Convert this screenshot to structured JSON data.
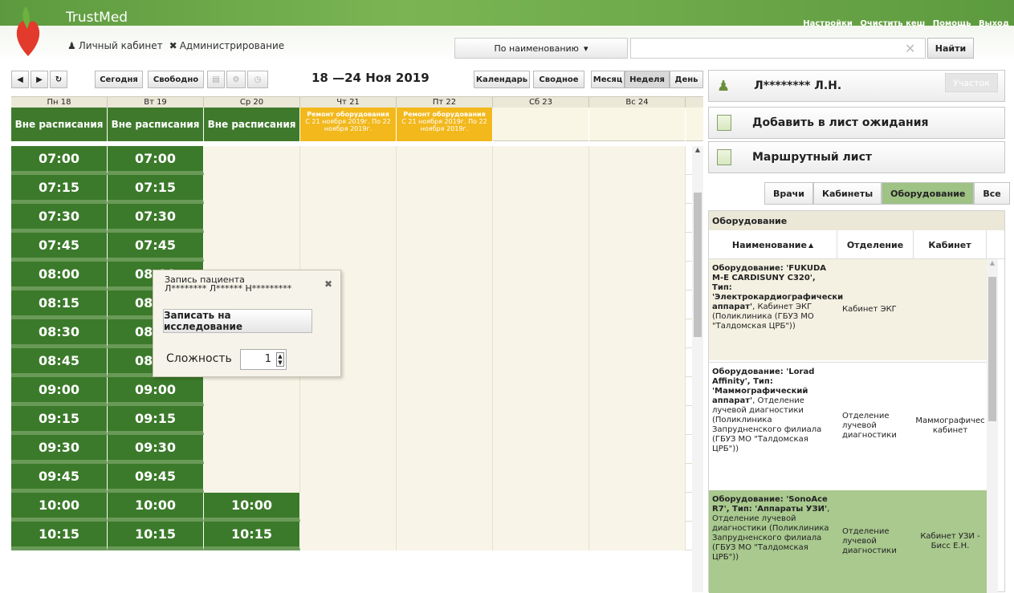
{
  "app": {
    "title": "TrustMed"
  },
  "top_links": [
    "Настройки",
    "Очистить кеш",
    "Помощь",
    "Выход"
  ],
  "nav": {
    "cabinet": "Личный кабинет",
    "admin": "Администрирование"
  },
  "search": {
    "mode": "По наименованию",
    "value": "",
    "button": "Найти"
  },
  "toolbar": {
    "today": "Сегодня",
    "free": "Свободно",
    "week_title": "18 —24 Ноя 2019",
    "views": [
      "Календарь",
      "Сводное",
      "Месяц",
      "Неделя",
      "День"
    ]
  },
  "days": [
    "Пн 18",
    "Вт 19",
    "Ср 20",
    "Чт 21",
    "Пт 22",
    "Сб 23",
    "Вс 24"
  ],
  "offschedule": {
    "label": "Вне расписания",
    "repair_line1": "Ремонт оборудования",
    "repair_line2": "С 21 ноября 2019г. По 22 ноября 2019г."
  },
  "times": [
    "07:00",
    "07:15",
    "07:30",
    "07:45",
    "08:00",
    "08:15",
    "08:30",
    "08:45",
    "09:00",
    "09:15",
    "09:30",
    "09:45",
    "10:00",
    "10:15"
  ],
  "popup": {
    "title": "Запись пациента",
    "patient": "Л******** Л****** Н*********",
    "button": "Записать на исследование",
    "complexity_label": "Сложность",
    "complexity_value": "1"
  },
  "right": {
    "patient_name": "Л******** Л.Н.",
    "district_button": "Участок",
    "waitlist": "Добавить в лист ожидания",
    "route": "Маршрутный лист",
    "tabs": [
      "Врачи",
      "Кабинеты",
      "Оборудование",
      "Все"
    ],
    "active_tab": "Оборудование",
    "panel_title": "Оборудование",
    "columns": [
      "Наименование",
      "Отделение",
      "Кабинет"
    ],
    "rows": [
      {
        "name": "Оборудование: 'FUKUDA M-E CARDISUNY C320', Тип: 'Электрокардиографически аппарат'",
        "location": "Кабинет ЭКГ (Поликлиника (ГБУЗ МО \"Талдомская ЦРБ\"))",
        "department": "Кабинет ЭКГ",
        "room": ""
      },
      {
        "name": "Оборудование: 'Lorad Affinity', Тип: 'Маммографический аппарат'",
        "location": "Отделение лучевой диагностики (Поликлиника Запрудненского филиала (ГБУЗ МО \"Талдомская ЦРБ\"))",
        "department": "Отделение лучевой диагностики",
        "room": "Маммографичес кабинет"
      },
      {
        "name": "Оборудование: 'SonoAce R7', Тип: 'Аппараты УЗИ'",
        "location": "Отделение лучевой диагностики (Поликлиника Запрудненского филиала (ГБУЗ МО \"Талдомская ЦРБ\"))",
        "department": "Отделение лучевой диагностики",
        "room": "Кабинет УЗИ - Бисс Е.Н."
      }
    ]
  },
  "colors": {
    "brand_green": "#3b7a2a",
    "repair_yellow": "#f2b81c",
    "selected_row": "#a9c98f"
  }
}
